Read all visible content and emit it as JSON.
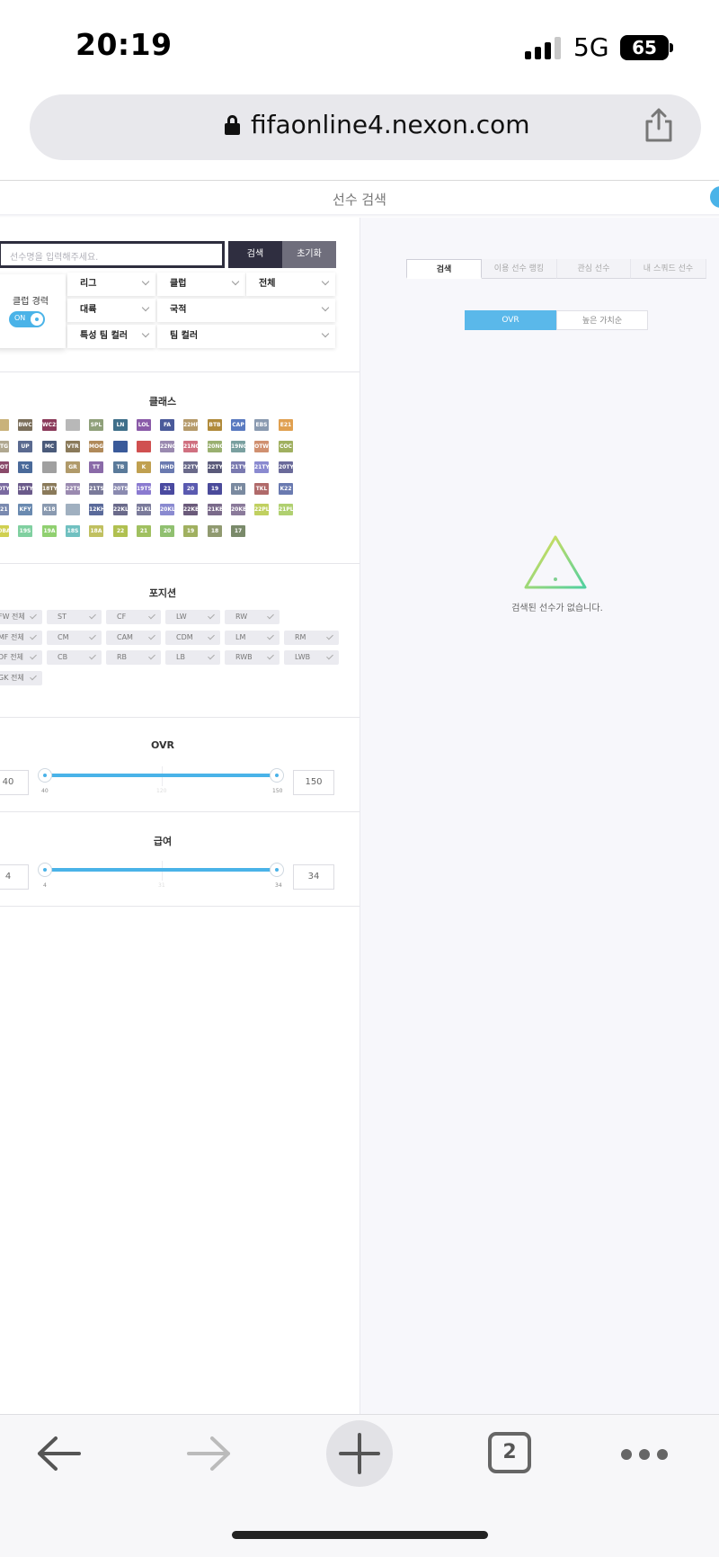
{
  "status": {
    "time": "20:19",
    "network": "5G",
    "battery": "65"
  },
  "browser": {
    "url": "fifaonline4.nexon.com",
    "tab_count": "2"
  },
  "page": {
    "title": "선수 검색"
  },
  "search": {
    "placeholder": "선수명을 입력해주세요.",
    "search_label": "검색",
    "reset_label": "초기화"
  },
  "club_career": {
    "label": "클럽 경력",
    "toggle": "ON"
  },
  "filters": {
    "league": "리그",
    "club": "클럽",
    "all": "전체",
    "continent": "대륙",
    "nationality": "국적",
    "special_team_color": "특성 팀 컬러",
    "team_color": "팀 컬러"
  },
  "classes": {
    "title": "클래스",
    "rows": [
      [
        {
          "t": "",
          "c": "#c9b27a"
        },
        {
          "t": "BWC",
          "c": "#7a6e5a"
        },
        {
          "t": "WC22",
          "c": "#8b3a5a"
        },
        {
          "t": "",
          "c": "#b8b8b8"
        },
        {
          "t": "SPL",
          "c": "#8fa07a"
        },
        {
          "t": "LN",
          "c": "#3f6f8a"
        },
        {
          "t": "LOL",
          "c": "#8a5aa8"
        },
        {
          "t": "FA",
          "c": "#4a5a9a"
        },
        {
          "t": "22HR",
          "c": "#b59a6a"
        },
        {
          "t": "BTB",
          "c": "#b08a3a"
        },
        {
          "t": "CAP",
          "c": "#5a7ac0"
        },
        {
          "t": "EBS",
          "c": "#8a9ab0"
        },
        {
          "t": "E21",
          "c": "#e0a050"
        }
      ],
      [
        {
          "t": "NTG",
          "c": "#b0a890"
        },
        {
          "t": "UP",
          "c": "#5a6a90"
        },
        {
          "t": "MC",
          "c": "#4a5a7a"
        },
        {
          "t": "VTR",
          "c": "#8a7a5a"
        },
        {
          "t": "MOG",
          "c": "#b08a5a"
        },
        {
          "t": "",
          "c": "#3a5a9a"
        },
        {
          "t": "",
          "c": "#d05050"
        },
        {
          "t": "22NG",
          "c": "#9a8ab0"
        },
        {
          "t": "21NG",
          "c": "#d07080"
        },
        {
          "t": "20NG",
          "c": "#9ab070"
        },
        {
          "t": "19NG",
          "c": "#7aa0a0"
        },
        {
          "t": "OTW",
          "c": "#d09070"
        },
        {
          "t": "COC",
          "c": "#a0b060"
        }
      ],
      [
        {
          "t": "HOT",
          "c": "#8a4a6a"
        },
        {
          "t": "TC",
          "c": "#4a6a9a"
        },
        {
          "t": "",
          "c": "#a0a0a0"
        },
        {
          "t": "GR",
          "c": "#b09a6a"
        },
        {
          "t": "TT",
          "c": "#8a6aa8"
        },
        {
          "t": "TB",
          "c": "#5a7a9a"
        },
        {
          "t": "K",
          "c": "#c0a050"
        },
        {
          "t": "NHD",
          "c": "#6a7ab0"
        },
        {
          "t": "22TY",
          "c": "#6a6a8a"
        },
        {
          "t": "22TY",
          "c": "#5a5a7a"
        },
        {
          "t": "21TY",
          "c": "#7a7ab0"
        },
        {
          "t": "21TY",
          "c": "#8a8ad0"
        },
        {
          "t": "20TY",
          "c": "#6a6a9a"
        }
      ],
      [
        {
          "t": "20TY",
          "c": "#7a6aa0"
        },
        {
          "t": "19TY",
          "c": "#6a5a8a"
        },
        {
          "t": "18TY",
          "c": "#8a7a5a"
        },
        {
          "t": "22TS",
          "c": "#9a8ab0"
        },
        {
          "t": "21TS",
          "c": "#7a7a9a"
        },
        {
          "t": "20TS",
          "c": "#8a8ab0"
        },
        {
          "t": "19TS",
          "c": "#8a7ad0"
        },
        {
          "t": "21",
          "c": "#4a4aa0"
        },
        {
          "t": "20",
          "c": "#5a5ab0"
        },
        {
          "t": "19",
          "c": "#4a4a9a"
        },
        {
          "t": "LH",
          "c": "#7a8aa0"
        },
        {
          "t": "TKL",
          "c": "#b06a6a"
        },
        {
          "t": "K22",
          "c": "#6a7ab0"
        }
      ],
      [
        {
          "t": "K21",
          "c": "#7a8ab0"
        },
        {
          "t": "KFY",
          "c": "#6a8ab0"
        },
        {
          "t": "K18",
          "c": "#8a9ab0"
        },
        {
          "t": "",
          "c": "#a0b0c0"
        },
        {
          "t": "12KH",
          "c": "#5a6a9a"
        },
        {
          "t": "22KL",
          "c": "#6a6a8a"
        },
        {
          "t": "21KL",
          "c": "#7a7a9a"
        },
        {
          "t": "20KL",
          "c": "#8a8ad0"
        },
        {
          "t": "22KB",
          "c": "#6a5a7a"
        },
        {
          "t": "21KB",
          "c": "#7a6a8a"
        },
        {
          "t": "20KB",
          "c": "#8a7a9a"
        },
        {
          "t": "22PL",
          "c": "#c0d060"
        },
        {
          "t": "21PL",
          "c": "#b0d070"
        }
      ],
      [
        {
          "t": "20BA",
          "c": "#d0d050"
        },
        {
          "t": "19S",
          "c": "#80d0a0"
        },
        {
          "t": "19A",
          "c": "#90d070"
        },
        {
          "t": "18S",
          "c": "#70c0c0"
        },
        {
          "t": "18A",
          "c": "#c0c060"
        },
        {
          "t": "22",
          "c": "#b0c050"
        },
        {
          "t": "21",
          "c": "#a0c060"
        },
        {
          "t": "20",
          "c": "#90c070"
        },
        {
          "t": "19",
          "c": "#a0b060"
        },
        {
          "t": "18",
          "c": "#909a70"
        },
        {
          "t": "17",
          "c": "#7a8a6a"
        }
      ]
    ]
  },
  "positions": {
    "title": "포지션",
    "rows": [
      [
        "FW 전체",
        "ST",
        "CF",
        "LW",
        "RW"
      ],
      [
        "MF 전체",
        "CM",
        "CAM",
        "CDM",
        "LM",
        "RM"
      ],
      [
        "DF 전체",
        "CB",
        "RB",
        "LB",
        "RWB",
        "LWB"
      ],
      [
        "GK 전체"
      ]
    ]
  },
  "ovr": {
    "title": "OVR",
    "min": "40",
    "max": "150",
    "tick_min": "40",
    "tick_mid": "120",
    "tick_max": "150",
    "low_fraction": 0.0,
    "high_fraction": 1.0
  },
  "salary": {
    "title": "급여",
    "min": "4",
    "max": "34",
    "tick_min": "4",
    "tick_mid": "31",
    "tick_max": "34",
    "low_fraction": 0.0,
    "high_fraction": 1.0
  },
  "right": {
    "tabs": [
      "검색",
      "이용 선수 랭킹",
      "관심 선수",
      "내 스쿼드 선수"
    ],
    "sort": {
      "ovr": "OVR",
      "value": "높은 가치순"
    },
    "empty_message": "검색된 선수가 없습니다.",
    "accent_color": "#4ab3e8"
  }
}
